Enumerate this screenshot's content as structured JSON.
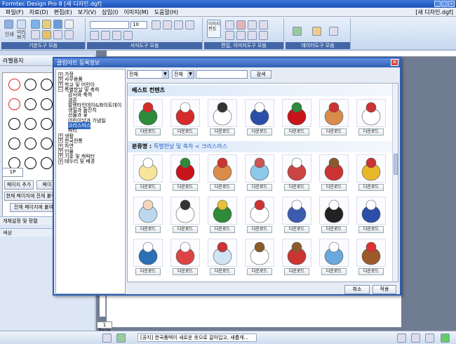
{
  "window": {
    "title": "Formtec Design Pro 8 [새 디자인.dgf]",
    "doc_label": "[새 디자인.dgf]"
  },
  "menu": [
    "파일(F)",
    "자료(D)",
    "편집(E)",
    "보기(V)",
    "삽입(I)",
    "이미지(M)",
    "도움말(H)"
  ],
  "ribbon": {
    "groups": [
      "기본도구 모음",
      "서식도구 모음",
      "편집, 이미지도구 모음",
      "데이터도구 모음"
    ],
    "btn_print": "인쇄",
    "btn_preview": "미리\n보기",
    "font_size": "10",
    "image_edit": "이미지\n편집"
  },
  "left_panel": {
    "title": "라벨용지",
    "page_tab": "1P",
    "add_page": "페이지 추가",
    "page_btn2": "페이",
    "apply_current": "현재 페이지에 전체 붙여",
    "apply_all": "전체 페이지에 붙여",
    "section1": "개체설정 및 정렬",
    "section2": "색상"
  },
  "workspace": {
    "page_tab": "1 Page"
  },
  "status": {
    "notice": "[공지] 한국폼텍이 새로운 옷으로 갈아입고, 새롭게..."
  },
  "dialog": {
    "title": "클립아트 등록정보",
    "close": "✕",
    "tree": [
      {
        "label": "가정",
        "level": 0,
        "toggle": "+"
      },
      {
        "label": "사무용품",
        "level": 0,
        "toggle": "+"
      },
      {
        "label": "학교 및 어린이",
        "level": 0,
        "toggle": "+"
      },
      {
        "label": "특별한날 및 축하",
        "level": 0,
        "toggle": "−"
      },
      {
        "label": "감사와 축하",
        "level": 1
      },
      {
        "label": "결혼",
        "level": 1
      },
      {
        "label": "발렌타인데이&화이트데이",
        "level": 1
      },
      {
        "label": "생일과 돌잔치",
        "level": 1
      },
      {
        "label": "선물과 꽃",
        "level": 1
      },
      {
        "label": "어린이날과 기념일",
        "level": 1
      },
      {
        "label": "크리스마스",
        "level": 1,
        "selected": true
      },
      {
        "label": "파티",
        "level": 1
      },
      {
        "label": "생활",
        "level": 0,
        "toggle": "+"
      },
      {
        "label": "한국전통",
        "level": 0,
        "toggle": "+"
      },
      {
        "label": "자연",
        "level": 0,
        "toggle": "+"
      },
      {
        "label": "인물",
        "level": 0,
        "toggle": "+"
      },
      {
        "label": "기호 및 캐릭터",
        "level": 0,
        "toggle": "+"
      },
      {
        "label": "테두리 및 배경",
        "level": 0,
        "toggle": "+"
      }
    ],
    "filter1": "전체",
    "filter2": "전체",
    "search_value": "",
    "search_btn": "검색",
    "best_header": "베스트 컨텐츠",
    "category_prefix": "분류명 :",
    "category_path": "특별한날 및 축하 < 크리스마스",
    "download_label": "다운로드",
    "best_items": [
      "wreath",
      "santa",
      "snowman",
      "snowman-hat",
      "poinsettia",
      "church",
      "snowman-scarf"
    ],
    "grid_items": [
      [
        "angel",
        "poinsettia",
        "church",
        "village",
        "snow-house",
        "santa-sack",
        "bells"
      ],
      [
        "girl-prayer",
        "snowman",
        "xmas-tree",
        "snowman-red",
        "snowman-blue",
        "penguins",
        "snowman-hat"
      ],
      [
        "window",
        "snowman-knit",
        "snow-globe",
        "snowmen",
        "santa-sleigh",
        "ice-branch",
        "reindeer"
      ]
    ],
    "cancel": "취소",
    "apply": "적용"
  },
  "colors": {
    "accent": "#2f5fb4",
    "category": "#2a62c8",
    "panel": "#dce6f4"
  }
}
